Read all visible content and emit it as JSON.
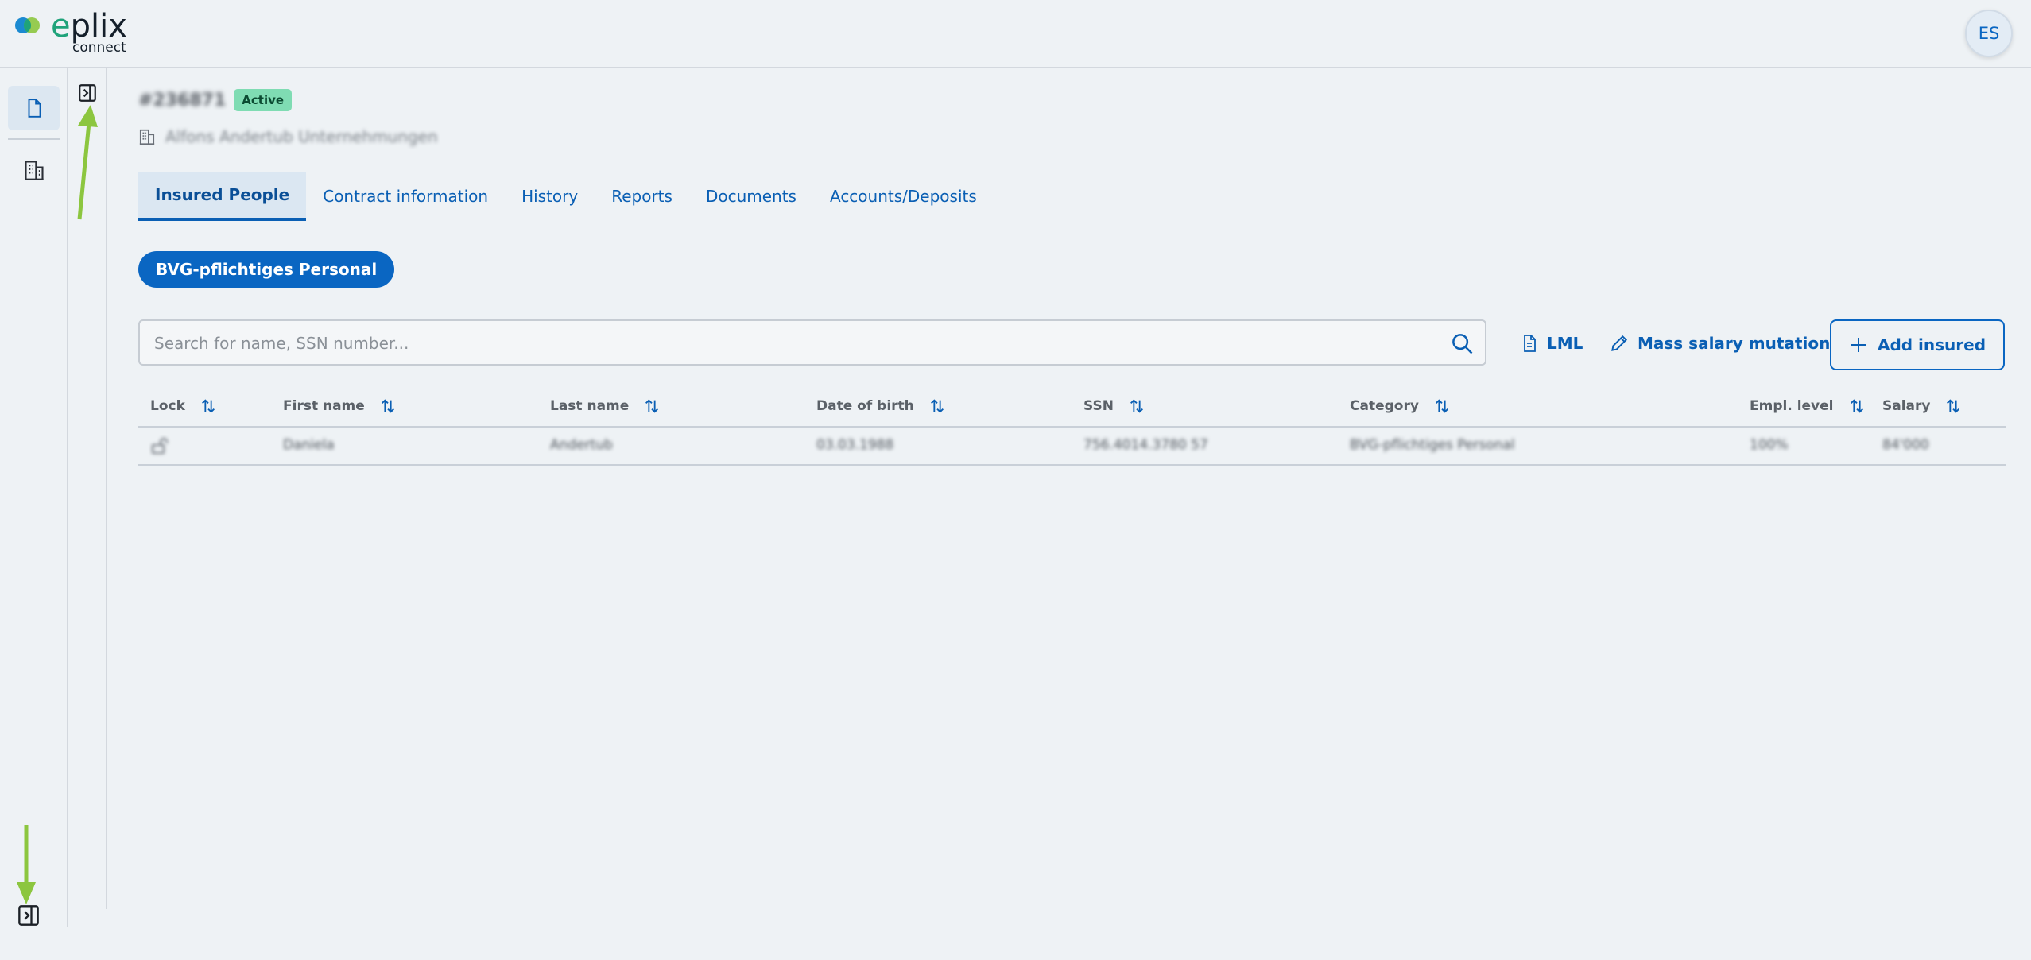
{
  "header": {
    "logo_word_e": "e",
    "logo_word_rest": "plix",
    "logo_sub": "connect",
    "user_initials": "ES"
  },
  "contract": {
    "number": "#236871",
    "status": "Active",
    "company": "Alfons Andertub Unternehmungen"
  },
  "tabs": [
    {
      "label": "Insured People"
    },
    {
      "label": "Contract information"
    },
    {
      "label": "History"
    },
    {
      "label": "Reports"
    },
    {
      "label": "Documents"
    },
    {
      "label": "Accounts/Deposits"
    }
  ],
  "filter_chip": "BVG-pflichtiges Personal",
  "search": {
    "placeholder": "Search for name, SSN number...",
    "value": ""
  },
  "actions": {
    "lml": "LML",
    "mass_salary": "Mass salary mutation",
    "add_insured": "Add insured"
  },
  "table": {
    "columns": [
      "Lock",
      "First name",
      "Last name",
      "Date of birth",
      "SSN",
      "Category",
      "Empl. level",
      "Salary"
    ],
    "rows": [
      [
        "",
        "Daniela",
        "Andertub",
        "03.03.1988",
        "756.4014.3780 57",
        "BVG-pflichtiges Personal",
        "100%",
        "84'000"
      ]
    ]
  },
  "colors": {
    "primary": "#0a66c2",
    "active_badge": "#7fdcb3",
    "arrow": "#8cc63f"
  }
}
